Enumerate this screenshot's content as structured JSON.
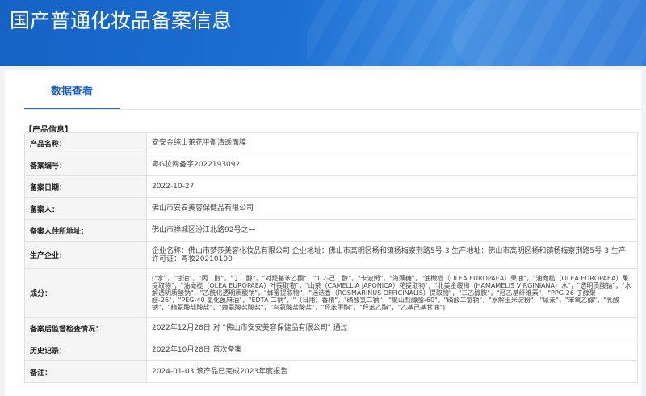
{
  "header": {
    "title": "国产普通化妆品备案信息"
  },
  "tabs": [
    {
      "label": "数据查看"
    }
  ],
  "section": {
    "label": "【产品信息】"
  },
  "rows": [
    {
      "key": "产品名称：",
      "value": "安安金纯山茶花平衡清透面膜"
    },
    {
      "key": "备案编号：",
      "value": "粤G妆网备字2022193092"
    },
    {
      "key": "备案日期：",
      "value": "2022-10-27"
    },
    {
      "key": "备案人：",
      "value": "佛山市安安美容保健品有限公司"
    },
    {
      "key": "备案人住所地址：",
      "value": "佛山市禅城区汾江北路92号之一"
    },
    {
      "key": "生产企业：",
      "value": "企业名称：佛山市梦莎美容化妆品有限公司 企业地址：佛山市高明区杨和镇杨梅寮荆路5号-3 生产地址：佛山市高明区杨和镇杨梅寮荆路5号-3 生产许可证：粤妆20210100"
    },
    {
      "key": "成分：",
      "value": "[\"水\"，\"甘油\"，\"丙二醇\"，\"丁二醇\"，\"对羟基苯乙酮\"，\"1,2-己二醇\"，\"卡波姆\"，\"海藻糖\"，\"油橄榄（OLEA EUROPAEA）果油\"，\"油橄榄（OLEA EUROPAEA）果提取物\"，\"油橄榄（OLEA EUROPAEA）叶提取物\"，\"山茶（CAMELLIA JAPONICA）花提取物\"，\"北美金缕梅（HAMAMELIS VIRGINIANA）水\"，\"透明质酸钠\"，\"水解透明质酸钠\"，\"乙酰化透明质酸钠\"，\"蜂蜜提取物\"，\"迷迭香（ROSMARINUS OFFICINALIS）提取物\"，\"三乙醇胺\"，\"羟乙基纤维素\"，\"PPG-26-丁醇聚醚-26\"，\"PEG-40 氢化蓖麻油\"，\"EDTA 二钠\"，\"（日用）香精\"，\"磷酸氢二钠\"，\"聚山梨醇酯-60\"，\"磷酸二氢钠\"，\"水解玉米淀粉\"，\"尿素\"，\"苯氧乙醇\"，\"乳酸钠\"，\"精氨酸盐酸盐\"，\"赖氨酸盐酸盐\"，\"鸟氨酸盐酸盐\"，\"羟苯甲酯\"，\"羟苯乙酯\"，\"乙基己基甘油\"]"
    },
    {
      "key": "备案后监督检查情况：",
      "value": "2022年12月28日 对 \"佛山市安安美容保健品有限公司\" 通过"
    },
    {
      "key": "历史记录：",
      "value": "2022年10月28日 首次备案"
    },
    {
      "key": "备注：",
      "value": "2024-01-03,该产品已完成2023年度报告"
    }
  ]
}
